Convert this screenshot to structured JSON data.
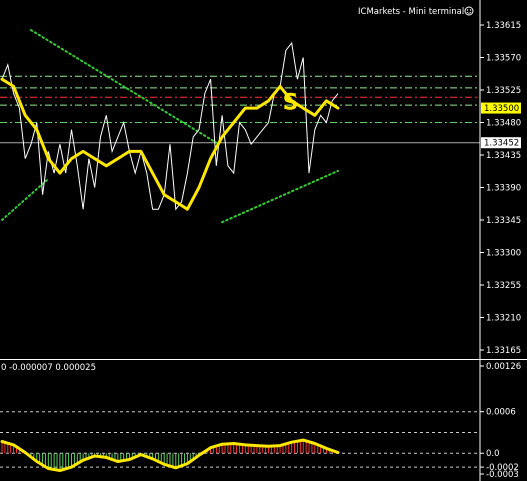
{
  "window": {
    "title": "ICMarkets - Mini terminal",
    "title_icon": "smiley-icon"
  },
  "chart_data": [
    {
      "type": "line",
      "ylim": [
        1.3314,
        1.3362
      ],
      "y_ticks": [
        "1.33615",
        "1.33570",
        "1.33525",
        "1.33480",
        "1.33435",
        "1.33390",
        "1.33345",
        "1.33300",
        "1.33255",
        "1.33210",
        "1.33165"
      ],
      "y_tick_values": [
        1.33615,
        1.3357,
        1.33525,
        1.3348,
        1.33435,
        1.3339,
        1.33345,
        1.333,
        1.33255,
        1.3321,
        1.33165
      ],
      "current_price": {
        "value": 1.33452,
        "label": "1.33452"
      },
      "level_tag": {
        "value": 1.335,
        "label": "1.33500",
        "color": "#ffff00"
      },
      "signal_marker": {
        "label": "S",
        "x": 50,
        "color": "#ffe800"
      },
      "colors": {
        "price": "#ffffff",
        "moving_average": "#ffe800",
        "trendlines": "#33cc33",
        "level_light_green": "#90ee90",
        "level_green": "#5fcf5f",
        "level_red": "#ff3333"
      },
      "horizontal_levels": [
        {
          "value": 1.33544,
          "style": "dashdot",
          "color": "#90ee90"
        },
        {
          "value": 1.33528,
          "style": "dashdot",
          "color": "#90ee90"
        },
        {
          "value": 1.33515,
          "style": "dashdot",
          "color": "#ff3333"
        },
        {
          "value": 1.33504,
          "style": "dashdot",
          "color": "#90ee90"
        },
        {
          "value": 1.3348,
          "style": "dashdot",
          "color": "#5fcf5f"
        },
        {
          "value": 1.33452,
          "style": "solid",
          "color": "#aaaaaa"
        }
      ],
      "trendlines": [
        {
          "x": [
            5,
            37
          ],
          "y": [
            1.33608,
            1.33452
          ]
        },
        {
          "x": [
            0,
            8
          ],
          "y": [
            1.33345,
            1.33402
          ]
        },
        {
          "x": [
            38,
            58
          ],
          "y": [
            1.33342,
            1.33413
          ]
        }
      ],
      "series": [
        {
          "x": [
            0,
            1,
            2,
            3,
            4,
            5,
            6,
            7,
            8,
            9,
            10,
            11,
            12,
            13,
            14,
            15,
            16,
            17,
            18,
            19,
            20,
            21,
            22,
            23,
            24,
            25,
            26,
            27,
            28,
            29,
            30,
            31,
            32,
            33,
            34,
            35,
            36,
            37,
            38,
            39,
            40,
            41,
            42,
            43,
            44,
            45,
            46,
            47,
            48,
            49,
            50,
            51,
            52,
            53,
            54,
            55,
            56,
            57,
            58
          ],
          "values": [
            1.3354,
            1.3356,
            1.3352,
            1.335,
            1.3343,
            1.3345,
            1.3448,
            1.3338,
            1.3344,
            1.3341,
            1.3345,
            1.3341,
            1.3347,
            1.3342,
            1.3336,
            1.3343,
            1.3339,
            1.3346,
            1.3349,
            1.3344,
            1.3346,
            1.3448,
            1.3344,
            1.3441,
            1.3444,
            1.3441,
            1.3436,
            1.3436,
            1.3438,
            1.3445,
            1.3436,
            1.3437,
            1.3441,
            1.3446,
            1.3447,
            1.3452,
            1.3454,
            1.3442,
            1.3449,
            1.3442,
            1.3441,
            1.3448,
            1.3447,
            1.3445,
            1.3446,
            1.3447,
            1.3448,
            1.3452,
            1.3453,
            1.3458,
            1.3459,
            1.3454,
            1.3457,
            1.3441,
            1.3447,
            1.3449,
            1.3448,
            1.3451,
            1.3452
          ]
        },
        {
          "x": [
            0,
            2,
            4,
            6,
            8,
            10,
            12,
            14,
            16,
            18,
            20,
            22,
            24,
            26,
            28,
            30,
            32,
            34,
            36,
            38,
            40,
            42,
            44,
            46,
            48,
            50,
            52,
            54,
            56,
            58
          ],
          "values": [
            1.3354,
            1.3353,
            1.3349,
            1.3447,
            1.3443,
            1.3441,
            1.3443,
            1.3444,
            1.3443,
            1.3442,
            1.3443,
            1.3444,
            1.3444,
            1.3441,
            1.3438,
            1.3437,
            1.3436,
            1.3439,
            1.3443,
            1.3446,
            1.3448,
            1.345,
            1.345,
            1.3451,
            1.3453,
            1.3451,
            1.345,
            1.3449,
            1.3451,
            1.345
          ]
        }
      ]
    },
    {
      "type": "bar",
      "header": "0 -0.000007 0.000025",
      "ylim": [
        -0.00032,
        0.00135
      ],
      "y_ticks": [
        "0.00126",
        "0.0006",
        "0.0",
        "-0.0002",
        "-0.0003"
      ],
      "y_tick_values": [
        0.00126,
        0.0006,
        0.0,
        -0.0002,
        -0.0003
      ],
      "reference_levels": [
        0.0006,
        0.0003,
        0.0,
        -0.0002
      ],
      "colors": {
        "line": "#ffe800",
        "positive_bars": "#ff3333",
        "negative_bars": "#5fcf5f",
        "levels": "#cccccc"
      },
      "series": [
        {
          "x": [
            0,
            2,
            4,
            6,
            8,
            10,
            12,
            14,
            16,
            18,
            20,
            22,
            24,
            26,
            28,
            30,
            32,
            34,
            36,
            38,
            40,
            42,
            44,
            46,
            48,
            50,
            52,
            54,
            56,
            58
          ],
          "values": [
            0.00017,
            0.00012,
            1e-05,
            -0.00012,
            -0.00022,
            -0.00025,
            -0.0002,
            -0.0001,
            -4e-05,
            -6e-05,
            -0.00012,
            -9e-05,
            -2e-05,
            -8e-05,
            -0.00016,
            -0.00021,
            -0.00015,
            -3e-05,
            8e-05,
            0.00013,
            0.00014,
            0.00012,
            0.00011,
            0.0001,
            0.00011,
            0.00016,
            0.00019,
            0.00014,
            7e-05,
            1e-05
          ]
        }
      ]
    }
  ]
}
